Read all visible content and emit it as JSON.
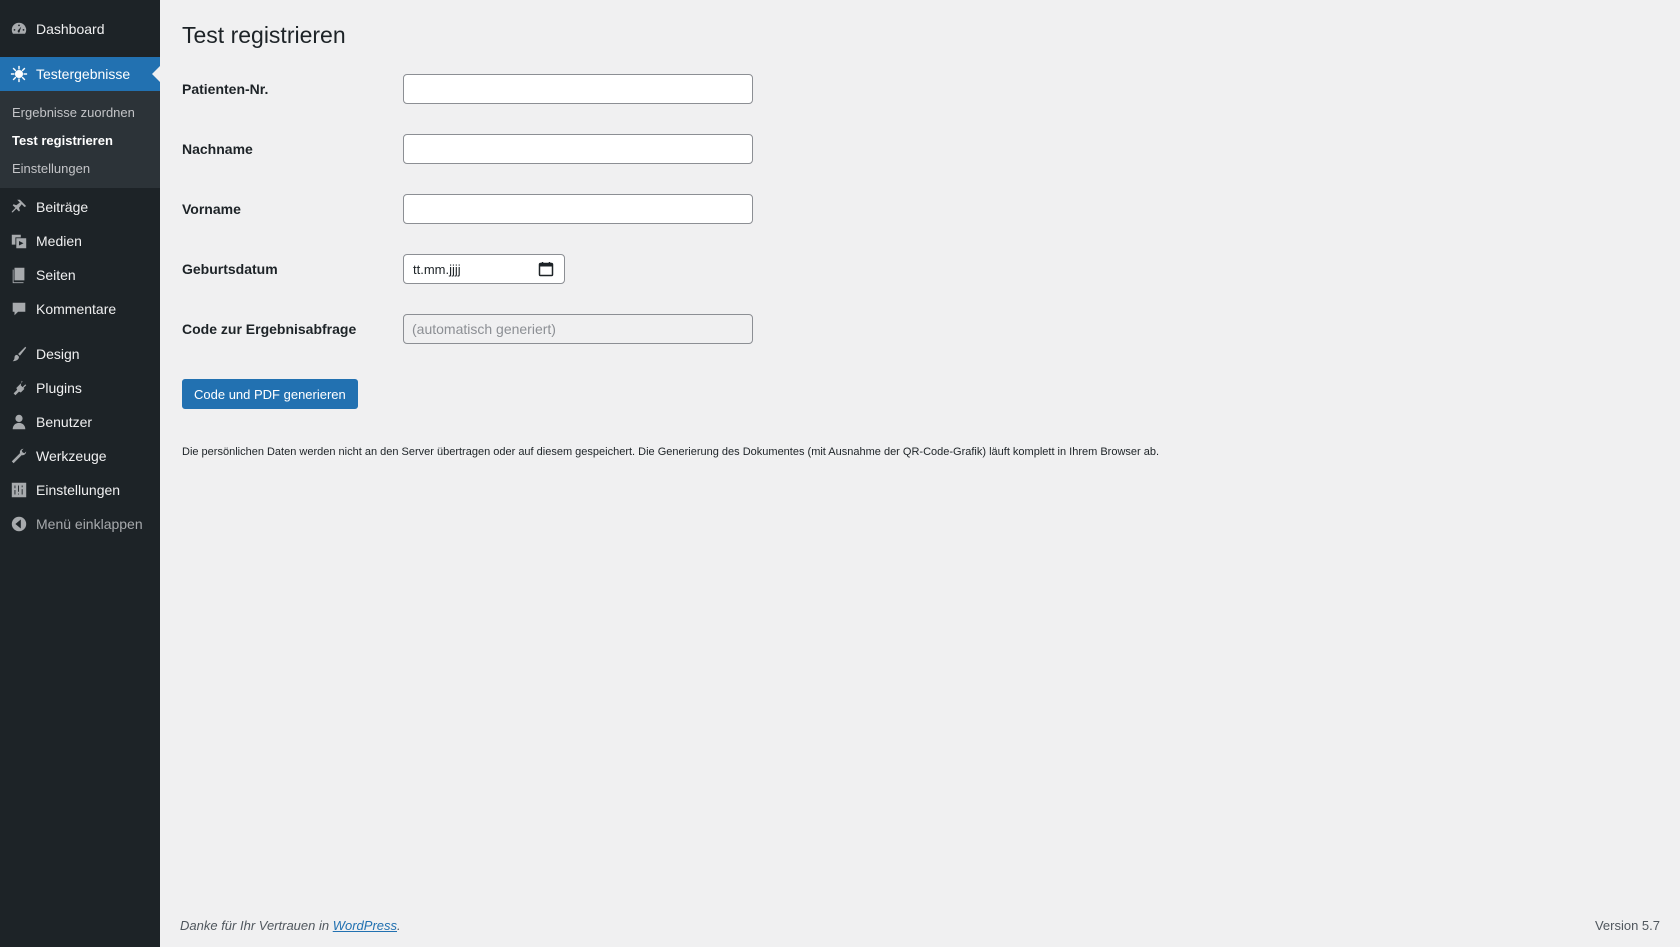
{
  "sidebar": {
    "top_items": [
      {
        "label": "Dashboard",
        "icon": "dashboard-icon"
      }
    ],
    "current": {
      "label": "Testergebnisse",
      "icon": "virus-icon"
    },
    "submenu": [
      {
        "label": "Ergebnisse zuordnen",
        "active": false
      },
      {
        "label": "Test registrieren",
        "active": true
      },
      {
        "label": "Einstellungen",
        "active": false
      }
    ],
    "items": [
      {
        "label": "Beiträge",
        "icon": "pin-icon"
      },
      {
        "label": "Medien",
        "icon": "media-icon"
      },
      {
        "label": "Seiten",
        "icon": "pages-icon"
      },
      {
        "label": "Kommentare",
        "icon": "comment-icon"
      },
      {
        "label": "Design",
        "icon": "brush-icon"
      },
      {
        "label": "Plugins",
        "icon": "plugin-icon"
      },
      {
        "label": "Benutzer",
        "icon": "user-icon"
      },
      {
        "label": "Werkzeuge",
        "icon": "wrench-icon"
      },
      {
        "label": "Einstellungen",
        "icon": "settings-icon"
      }
    ],
    "collapse_label": "Menü einklappen",
    "accent_color": "#2271b1",
    "background_color": "#1d2327"
  },
  "main": {
    "title": "Test registrieren",
    "fields": {
      "patient_nr": {
        "label": "Patienten-Nr.",
        "value": ""
      },
      "nachname": {
        "label": "Nachname",
        "value": ""
      },
      "vorname": {
        "label": "Vorname",
        "value": ""
      },
      "geburtsdatum": {
        "label": "Geburtsdatum",
        "placeholder": "tt.mm.jjjj"
      },
      "code": {
        "label": "Code zur Ergebnisabfrage",
        "placeholder": "(automatisch generiert)"
      }
    },
    "submit_label": "Code und PDF generieren",
    "note": "Die persönlichen Daten werden nicht an den Server übertragen oder auf diesem gespeichert. Die Generierung des Dokumentes (mit Ausnahme der QR-Code-Grafik) läuft komplett in Ihrem Browser ab."
  },
  "footer": {
    "thanks_prefix": "Danke für Ihr Vertrauen in ",
    "thanks_link": "WordPress",
    "thanks_suffix": ".",
    "version": "Version 5.7"
  }
}
